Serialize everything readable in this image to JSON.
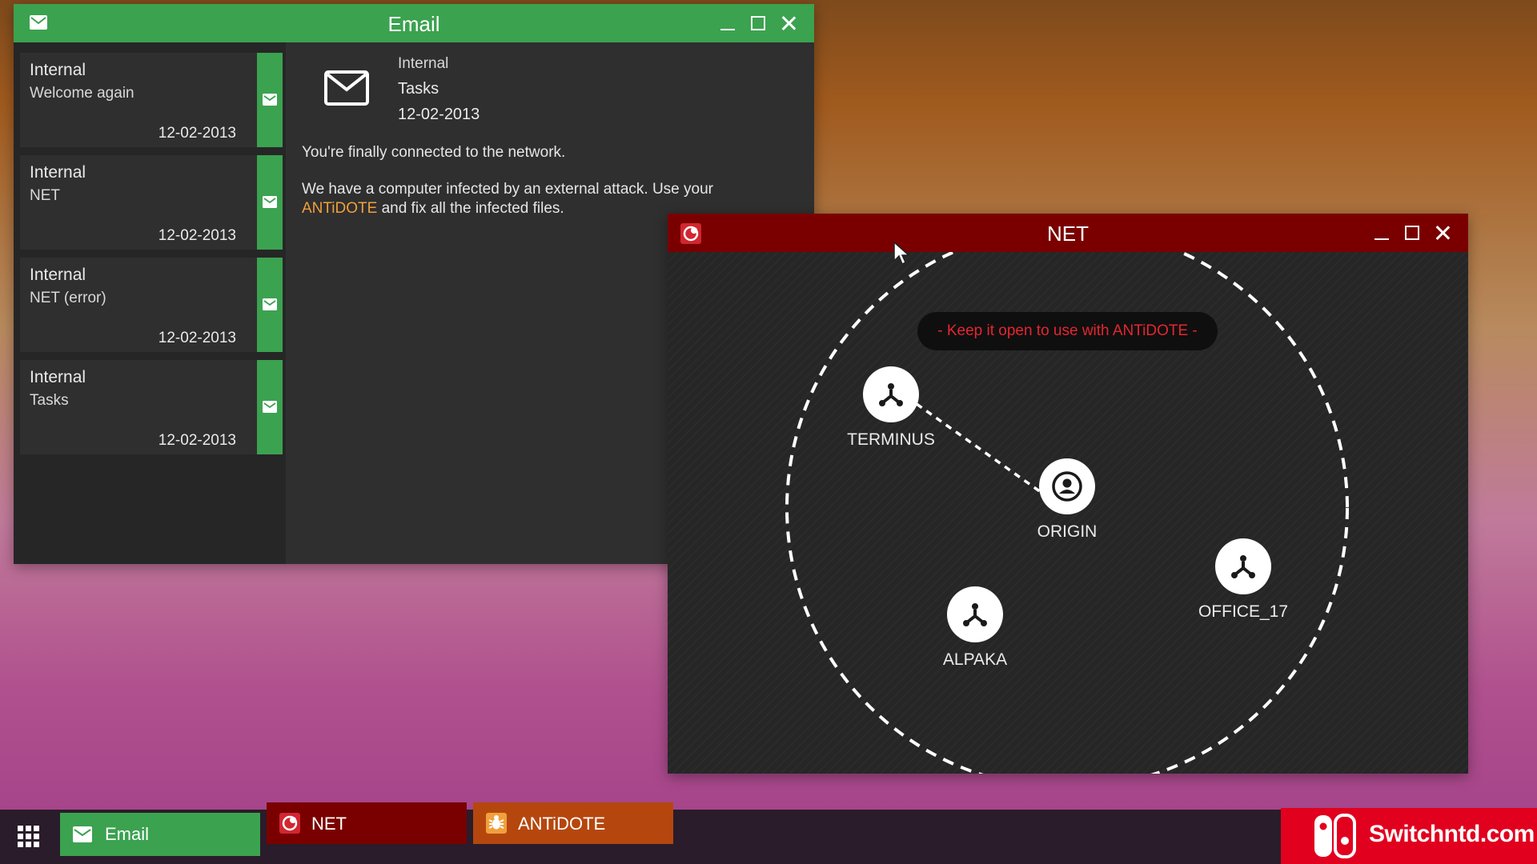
{
  "email_window": {
    "title": "Email",
    "messages": [
      {
        "from": "Internal",
        "subject": "Welcome again",
        "date": "12-02-2013"
      },
      {
        "from": "Internal",
        "subject": "NET",
        "date": "12-02-2013"
      },
      {
        "from": "Internal",
        "subject": "NET (error)",
        "date": "12-02-2013"
      },
      {
        "from": "Internal",
        "subject": "Tasks",
        "date": "12-02-2013"
      }
    ],
    "reader": {
      "from": "Internal",
      "subject": "Tasks",
      "date": "12-02-2013",
      "body_line1": "You're finally connected to the network.",
      "body_line2_part1": "We have a computer infected by an external attack. Use your",
      "body_highlight": "ANTiDOTE",
      "body_line2_part2": " and fix all the infected files."
    }
  },
  "net_window": {
    "title": "NET",
    "hint": "- Keep it open to use with ANTiDOTE -",
    "nodes": {
      "terminus": "TERMINUS",
      "origin": "ORIGIN",
      "office": "OFFICE_17",
      "alpaka": "ALPAKA"
    }
  },
  "taskbar": {
    "email": "Email",
    "net": "NET",
    "antidote": "ANTiDOTE"
  },
  "brand": {
    "text": "Switchntd.com"
  },
  "colors": {
    "email_green": "#3ba250",
    "net_red": "#7a0000",
    "antidote_orange": "#b5470e",
    "highlight_orange": "#f0a03c",
    "hint_red": "#e52630"
  }
}
